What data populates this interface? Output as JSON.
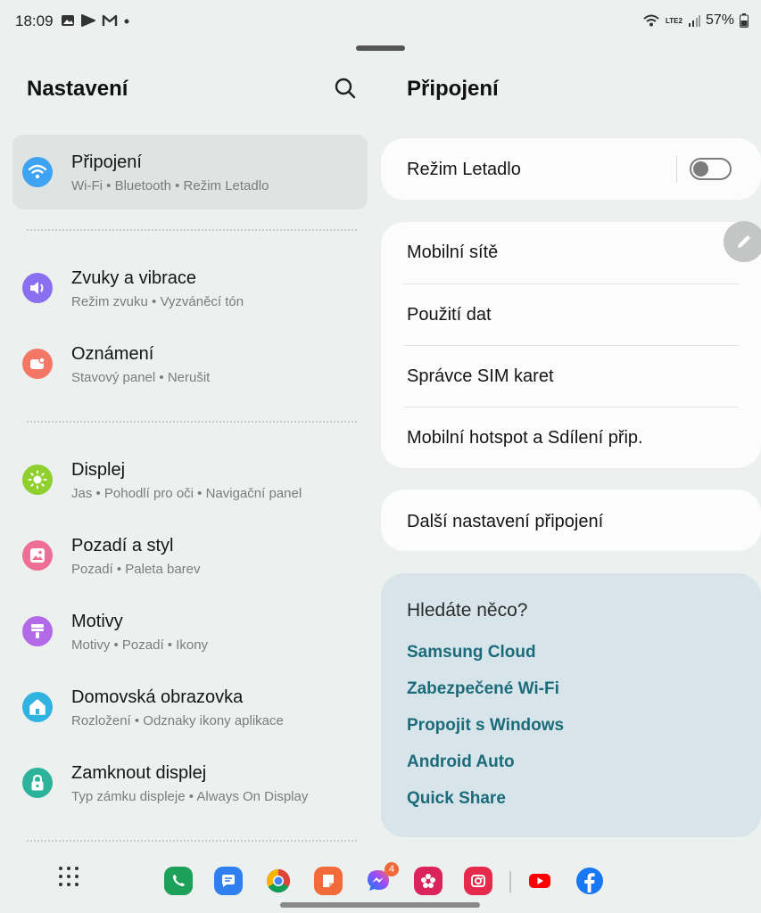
{
  "status_bar": {
    "time": "18:09",
    "left_icons": [
      "gallery-icon",
      "play-icon",
      "gmail-icon",
      "dot-icon"
    ],
    "network": "LTE2",
    "battery": "57%"
  },
  "left_pane": {
    "title": "Nastavení",
    "items": [
      {
        "title": "Připojení",
        "subtitle": "Wi-Fi • Bluetooth • Režim Letadlo",
        "icon": "wifi-icon",
        "color": "#3ea3f2",
        "selected": true
      },
      {
        "title": "Zvuky a vibrace",
        "subtitle": "Režim zvuku • Vyzváněcí tón",
        "icon": "speaker-icon",
        "color": "#8a6ff0"
      },
      {
        "title": "Oznámení",
        "subtitle": "Stavový panel • Nerušit",
        "icon": "notification-icon",
        "color": "#f47766"
      },
      {
        "title": "Displej",
        "subtitle": "Jas • Pohodlí pro oči • Navigační panel",
        "icon": "sun-icon",
        "color": "#8fcf2e"
      },
      {
        "title": "Pozadí a styl",
        "subtitle": "Pozadí • Paleta barev",
        "icon": "image-icon",
        "color": "#ef6e96"
      },
      {
        "title": "Motivy",
        "subtitle": "Motivy • Pozadí • Ikony",
        "icon": "brush-icon",
        "color": "#b36ae8"
      },
      {
        "title": "Domovská obrazovka",
        "subtitle": "Rozložení • Odznaky ikony aplikace",
        "icon": "home-icon",
        "color": "#30b3e0"
      },
      {
        "title": "Zamknout displej",
        "subtitle": "Typ zámku displeje • Always On Display",
        "icon": "lock-icon",
        "color": "#2db39c"
      }
    ]
  },
  "right_pane": {
    "title": "Připojení",
    "airplane": {
      "label": "Režim Letadlo",
      "enabled": false
    },
    "group_items": [
      "Mobilní sítě",
      "Použití dat",
      "Správce SIM karet",
      "Mobilní hotspot a Sdílení přip."
    ],
    "more_label": "Další nastavení připojení",
    "suggest": {
      "title": "Hledáte něco?",
      "links": [
        "Samsung Cloud",
        "Zabezpečené Wi-Fi",
        "Propojit s Windows",
        "Android Auto",
        "Quick Share"
      ]
    }
  },
  "dock": {
    "apps": [
      {
        "name": "phone-icon",
        "color": "#1ca05a"
      },
      {
        "name": "messages-icon",
        "color": "#2f7ff0"
      },
      {
        "name": "chrome-icon",
        "color": "#ffffff"
      },
      {
        "name": "notes-icon",
        "color": "#f26a3a"
      },
      {
        "name": "messenger-icon",
        "color": "#ffffff"
      },
      {
        "name": "flower-icon",
        "color": "#d9245c"
      },
      {
        "name": "camera-icon",
        "color": "#e52a4d"
      },
      {
        "name": "youtube-icon",
        "color": "#ffffff"
      },
      {
        "name": "facebook-icon",
        "color": "#1877f2"
      }
    ],
    "messenger_badge": "4"
  }
}
